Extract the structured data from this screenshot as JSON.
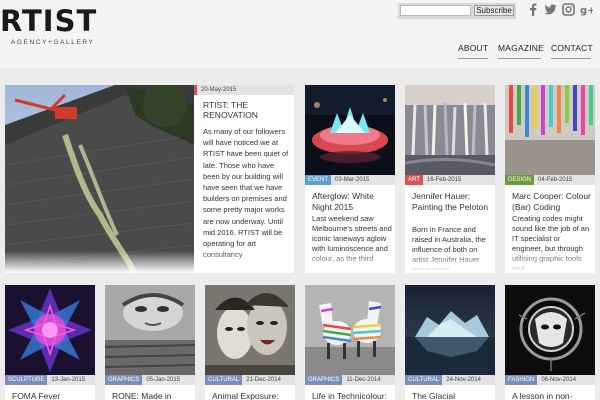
{
  "brand": {
    "logo": "RTIST",
    "tagline": "AGENCY+GALLERY"
  },
  "search": {
    "placeholder": "",
    "value": "",
    "button_label": "Subscribe"
  },
  "social": [
    "facebook-icon",
    "twitter-icon",
    "instagram-icon",
    "google-plus-icon"
  ],
  "nav": [
    {
      "label": "ABOUT",
      "active": false
    },
    {
      "label": "MAGAZINE",
      "active": true
    },
    {
      "label": "CONTACT",
      "active": false
    }
  ],
  "colors": {
    "tag_event": "#5aa0d0",
    "tag_art": "#d9534f",
    "tag_design": "#6c9a3a",
    "tag_sculpture": "#7b8fb8",
    "tag_graphics": "#7b8fb8",
    "tag_cultural": "#7b8fb8",
    "tag_fashion": "#7b8fb8",
    "feature_stripe": "#d9534f"
  },
  "feature": {
    "date": "20-May-2015",
    "title": "RTIST: THE RENOVATION",
    "excerpt": "As many of our followers will have noticed we at RTIST have been quiet of late. Those who have been by our building will have seen that we have builders on premises and some pretty major works are now underway. Until mid 2016, RTIST will be operating for art consultancy"
  },
  "cards_row1": [
    {
      "category": "EVENT",
      "date": "03-Mar-2015",
      "title": "Afterglow: White Night 2015",
      "excerpt": "Last weekend saw Melbourne's streets and iconic laneways aglow with luminoscence and colour, as the third"
    },
    {
      "category": "ART",
      "date": "16-Feb-2015",
      "title": "Jennifer Hauer: Painting the Peloton",
      "excerpt": "Born in France and raised in Australia, the influence of both on artist Jennifer Hauer are evident"
    },
    {
      "category": "DESIGN",
      "date": "04-Feb-2015",
      "title": "Marc Cooper: Colour (Bar) Coding",
      "excerpt": "Creating codes might sound like the job of an IT specialist or engineer, but through utilising graphic tools and"
    }
  ],
  "cards_row2": [
    {
      "category": "SCULPTURE",
      "date": "13-Jan-2015",
      "title": "FOMA Fever"
    },
    {
      "category": "GRAPHICS",
      "date": "05-Jan-2015",
      "title": "RONE: Made in"
    },
    {
      "category": "CULTURAL",
      "date": "21-Dec-2014",
      "title": "Animal Exposure:"
    },
    {
      "category": "GRAPHICS",
      "date": "11-Dec-2014",
      "title": "Life in Technicolour:"
    },
    {
      "category": "CULTURAL",
      "date": "24-Nov-2014",
      "title": "The Glacial"
    },
    {
      "category": "FASHION",
      "date": "06-Nov-2014",
      "title": "A lesson in non-"
    }
  ]
}
